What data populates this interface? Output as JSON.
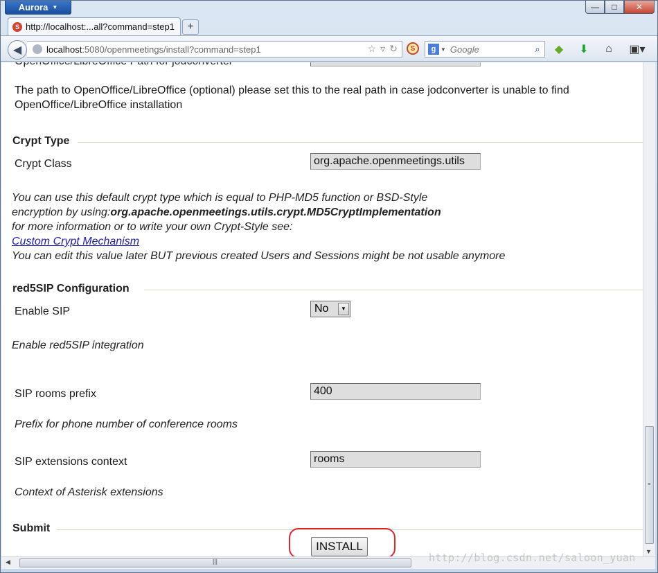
{
  "browser": {
    "app_menu_label": "Aurora",
    "tab_title": "http://localhost:...all?command=step1",
    "url_host": "localhost",
    "url_rest": ":5080/openmeetings/install?command=step1",
    "search_placeholder": "Google",
    "window_buttons": {
      "minimize": "—",
      "maximize": "□",
      "close": "✕"
    }
  },
  "page": {
    "cut_off_label": "OpenOffice/LibreOffice Path for jodconverter",
    "openoffice_help": "The path to OpenOffice/LibreOffice (optional) please set this to the real path in case jodconverter is unable to find",
    "openoffice_help_2": "OpenOffice/LibreOffice installation",
    "crypt": {
      "legend": "Crypt Type",
      "label": "Crypt Class",
      "value": "org.apache.openmeetings.utils",
      "help_line1": "You can use this default crypt type which is equal to PHP-MD5 function or BSD-Style",
      "help_line2_prefix": "encryption by using:",
      "help_line2_bold": "org.apache.openmeetings.utils.crypt.MD5CryptImplementation",
      "help_line3": "for more information or to write your own Crypt-Style see:",
      "link_text": "Custom Crypt Mechanism",
      "help_line5": "You can edit this value later BUT previous created Users and Sessions might be not usable anymore"
    },
    "sip": {
      "legend": "red5SIP Configuration",
      "enable_label": "Enable SIP",
      "enable_value": "No",
      "enable_help": "Enable red5SIP integration",
      "prefix_label": "SIP rooms prefix",
      "prefix_value": "400",
      "prefix_help": "Prefix for phone number of conference rooms",
      "context_label": "SIP extensions context",
      "context_value": "rooms",
      "context_help": "Context of Asterisk extensions"
    },
    "submit": {
      "legend": "Submit",
      "button_label": "INSTALL"
    }
  },
  "watermark": "http://blog.csdn.net/saloon_yuan",
  "colors": {
    "highlight": "#e0262a",
    "link": "#1b1bb8"
  }
}
